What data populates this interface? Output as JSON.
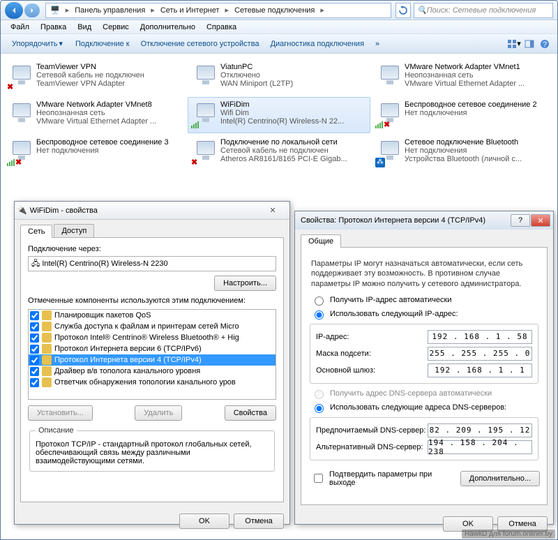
{
  "breadcrumb": {
    "root": "Панель управления",
    "sub": "Сеть и Интернет",
    "leaf": "Сетевые подключения"
  },
  "search": {
    "placeholder": "Поиск: Сетевые подключения"
  },
  "menu": {
    "file": "Файл",
    "edit": "Правка",
    "view": "Вид",
    "service": "Сервис",
    "extra": "Дополнительно",
    "help": "Справка"
  },
  "toolbar": {
    "org": "Упорядочить",
    "connect": "Подключение к",
    "disable": "Отключение сетевого устройства",
    "diag": "Диагностика подключения"
  },
  "connections": [
    {
      "name": "TeamViewer VPN",
      "status": "Сетевой кабель не подключен",
      "device": "TeamViewer VPN Adapter",
      "overlay": "x"
    },
    {
      "name": "ViatunPC",
      "status": "Отключено",
      "device": "WAN Miniport (L2TP)",
      "overlay": "none"
    },
    {
      "name": "VMware Network Adapter VMnet1",
      "status": "Неопознанная сеть",
      "device": "VMware Virtual Ethernet Adapter ...",
      "overlay": "none"
    },
    {
      "name": "VMware Network Adapter VMnet8",
      "status": "Неопознанная сеть",
      "device": "VMware Virtual Ethernet Adapter ...",
      "overlay": "none"
    },
    {
      "name": "WiFiDim",
      "status": "Wifi Dim",
      "device": "Intel(R) Centrino(R) Wireless-N 22...",
      "overlay": "signal",
      "selected": true
    },
    {
      "name": "Беспроводное сетевое соединение 2",
      "status": "Нет подключения",
      "device": "",
      "overlay": "signalx"
    },
    {
      "name": "Беспроводное сетевое соединение 3",
      "status": "Нет подключения",
      "device": "",
      "overlay": "signalx"
    },
    {
      "name": "Подключение по локальной сети",
      "status": "Сетевой кабель не подключен",
      "device": "Atheros AR8161/8165 PCI-E Gigab...",
      "overlay": "x"
    },
    {
      "name": "Сетевое подключение Bluetooth",
      "status": "Нет подключения",
      "device": "Устройства Bluetooth (личной с...",
      "overlay": "bt"
    }
  ],
  "dlg1": {
    "title": "WiFiDim - свойства",
    "tab_net": "Сеть",
    "tab_access": "Доступ",
    "connect_via": "Подключение через:",
    "adapter": "Intel(R) Centrino(R) Wireless-N 2230",
    "configure": "Настроить...",
    "components_label": "Отмеченные компоненты используются этим подключением:",
    "components": [
      "Планировщик пакетов QoS",
      "Служба доступа к файлам и принтерам сетей Micro",
      "Протокол Intel® Centrino® Wireless Bluetooth® + Hig",
      "Протокол Интернета версии 6 (TCP/IPv6)",
      "Протокол Интернета версии 4 (TCP/IPv4)",
      "Драйвер в/в тополога канального уровня",
      "Ответчик обнаружения топологии канального уров"
    ],
    "install": "Установить...",
    "remove": "Удалить",
    "props": "Свойства",
    "desc_legend": "Описание",
    "desc": "Протокол TCP/IP - стандартный протокол глобальных сетей, обеспечивающий связь между различными взаимодействующими сетями.",
    "ok": "OK",
    "cancel": "Отмена"
  },
  "dlg2": {
    "title": "Свойства: Протокол Интернета версии 4 (TCP/IPv4)",
    "tab_general": "Общие",
    "info": "Параметры IP могут назначаться автоматически, если сеть поддерживает эту возможность. В противном случае параметры IP можно получить у сетевого администратора.",
    "radio_auto_ip": "Получить IP-адрес автоматически",
    "radio_use_ip": "Использовать следующий IP-адрес:",
    "lbl_ip": "IP-адрес:",
    "val_ip": "192 . 168 .  1  .  58",
    "lbl_mask": "Маска подсети:",
    "val_mask": "255 . 255 . 255 .  0",
    "lbl_gw": "Основной шлюз:",
    "val_gw": "192 . 168 .  1  .  1",
    "radio_auto_dns": "Получить адрес DNS-сервера автоматически",
    "radio_use_dns": "Использовать следующие адреса DNS-серверов:",
    "lbl_dns1": "Предпочитаемый DNS-сервер:",
    "val_dns1": "82 . 209 . 195 .  12",
    "lbl_dns2": "Альтернативный DNS-сервер:",
    "val_dns2": "194 . 158 . 204 . 238",
    "confirm": "Подтвердить параметры при выходе",
    "advanced": "Дополнительно...",
    "ok": "OK",
    "cancel": "Отмена"
  },
  "watermark": "HawkD для forum.onliner.by"
}
